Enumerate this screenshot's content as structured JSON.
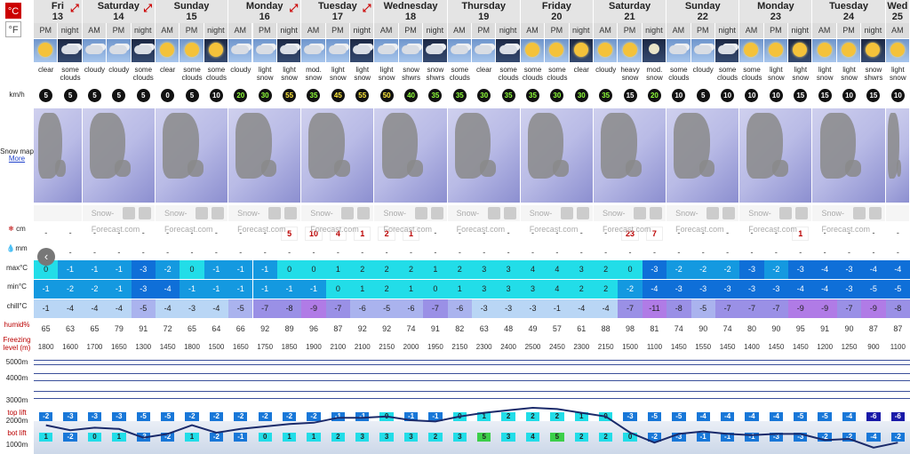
{
  "units": {
    "celsius": "°C",
    "fahrenheit": "°F"
  },
  "labels": {
    "wind": "km/h",
    "snowmap": "Snow map",
    "more": "More",
    "snow_cm": "cm",
    "rain_mm": "mm",
    "max": "max°C",
    "min": "min°C",
    "chill": "chill°C",
    "humid": "humid%",
    "freezing": "Freezing level (m)",
    "m5000": "5000m",
    "m4000": "4000m",
    "m3000": "3000m",
    "m2000": "2000m",
    "m1000": "1000m",
    "top_lift": "top lift",
    "bot_lift": "bot lift",
    "brand": "Snow-Forecast.com"
  },
  "days": [
    {
      "name": "Fri",
      "date": "13",
      "arrow": true,
      "periods": 2
    },
    {
      "name": "Saturday",
      "date": "14",
      "arrow": true,
      "periods": 3
    },
    {
      "name": "Sunday",
      "date": "15",
      "arrow": false,
      "periods": 3
    },
    {
      "name": "Monday",
      "date": "16",
      "arrow": true,
      "periods": 3
    },
    {
      "name": "Tuesday",
      "date": "17",
      "arrow": true,
      "periods": 3
    },
    {
      "name": "Wednesday",
      "date": "18",
      "arrow": false,
      "periods": 3
    },
    {
      "name": "Thursday",
      "date": "19",
      "arrow": false,
      "periods": 3
    },
    {
      "name": "Friday",
      "date": "20",
      "arrow": false,
      "periods": 3
    },
    {
      "name": "Saturday",
      "date": "21",
      "arrow": false,
      "periods": 3
    },
    {
      "name": "Sunday",
      "date": "22",
      "arrow": false,
      "periods": 3
    },
    {
      "name": "Monday",
      "date": "23",
      "arrow": false,
      "periods": 3
    },
    {
      "name": "Tuesday",
      "date": "24",
      "arrow": false,
      "periods": 3
    },
    {
      "name": "Wed",
      "date": "25",
      "arrow": false,
      "periods": 1
    }
  ],
  "periods": [
    "PM",
    "night",
    "AM",
    "PM",
    "night",
    "AM",
    "PM",
    "night",
    "AM",
    "PM",
    "night",
    "AM",
    "PM",
    "night",
    "AM",
    "PM",
    "night",
    "AM",
    "PM",
    "night",
    "AM",
    "PM",
    "night",
    "AM",
    "PM",
    "night",
    "AM",
    "PM",
    "night",
    "AM",
    "PM",
    "night",
    "AM",
    "PM",
    "night",
    "AM"
  ],
  "icons": [
    "sun",
    "cloud-night",
    "cloud",
    "cloud",
    "cloud-night",
    "sun",
    "sun",
    "sun",
    "cloud",
    "cloud",
    "cloud-night",
    "cloud",
    "cloud",
    "cloud",
    "cloud",
    "cloud",
    "cloud",
    "cloud",
    "cloud",
    "cloud",
    "sun",
    "sun",
    "sun",
    "sun",
    "sun",
    "moon",
    "cloud",
    "cloud",
    "cloud-night",
    "sun",
    "sun",
    "sun",
    "sun",
    "sun",
    "sun",
    "sun"
  ],
  "desc": [
    "clear",
    "some clouds",
    "cloudy",
    "cloudy",
    "some clouds",
    "clear",
    "some clouds",
    "some clouds",
    "cloudy",
    "light snow",
    "light snow",
    "mod. snow",
    "light snow",
    "light snow",
    "light snow",
    "snow shwrs",
    "snow shwrs",
    "some clouds",
    "clear",
    "some clouds",
    "some clouds",
    "some clouds",
    "clear",
    "cloudy",
    "heavy snow",
    "mod. snow",
    "some clouds",
    "cloudy",
    "some clouds",
    "some clouds",
    "light snow",
    "light snow",
    "light snow",
    "light snow",
    "snow shwrs",
    "light snow"
  ],
  "wind": [
    "5",
    "5",
    "5",
    "5",
    "5",
    "0",
    "5",
    "10",
    "20",
    "30",
    "55",
    "35",
    "45",
    "55",
    "50",
    "40",
    "35",
    "35",
    "30",
    "35",
    "35",
    "30",
    "30",
    "35",
    "15",
    "20",
    "10",
    "5",
    "10",
    "10",
    "10",
    "15",
    "15",
    "10",
    "15",
    "10"
  ],
  "snow": [
    "-",
    "-",
    "-",
    "-",
    "-",
    "-",
    "-",
    "-",
    "-",
    "-",
    "5",
    "10",
    "4",
    "1",
    "2",
    "1",
    "-",
    "-",
    "-",
    "-",
    "-",
    "-",
    "-",
    "-",
    "23",
    "7",
    "-",
    "-",
    "-",
    "-",
    "-",
    "1",
    "-",
    "-",
    "-",
    "-"
  ],
  "rain": [
    "-",
    "-",
    "-",
    "-",
    "-",
    "-",
    "-",
    "-",
    "-",
    "-",
    "-",
    "-",
    "-",
    "-",
    "-",
    "-",
    "-",
    "-",
    "-",
    "-",
    "-",
    "-",
    "-",
    "-",
    "-",
    "-",
    "-",
    "-",
    "-",
    "-",
    "-",
    "-",
    "-",
    "-",
    "-",
    "-"
  ],
  "max": [
    "0",
    "-1",
    "-1",
    "-1",
    "-3",
    "-2",
    "0",
    "-1",
    "-1",
    "-1",
    "0",
    "0",
    "1",
    "2",
    "2",
    "2",
    "1",
    "2",
    "3",
    "3",
    "4",
    "4",
    "3",
    "2",
    "0",
    "-3",
    "-2",
    "-2",
    "-2",
    "-3",
    "-2",
    "-3",
    "-4",
    "-3",
    "-4",
    "-4"
  ],
  "min": [
    "-1",
    "-2",
    "-2",
    "-1",
    "-3",
    "-4",
    "-1",
    "-1",
    "-1",
    "-1",
    "-1",
    "-1",
    "0",
    "1",
    "2",
    "1",
    "0",
    "1",
    "3",
    "3",
    "3",
    "4",
    "2",
    "2",
    "-2",
    "-4",
    "-3",
    "-3",
    "-3",
    "-3",
    "-3",
    "-4",
    "-4",
    "-3",
    "-5",
    "-5"
  ],
  "chill": [
    "-1",
    "-4",
    "-4",
    "-4",
    "-5",
    "-4",
    "-3",
    "-4",
    "-5",
    "-7",
    "-8",
    "-9",
    "-7",
    "-6",
    "-5",
    "-6",
    "-7",
    "-6",
    "-3",
    "-3",
    "-3",
    "-1",
    "-4",
    "-4",
    "-7",
    "-11",
    "-8",
    "-5",
    "-7",
    "-7",
    "-7",
    "-9",
    "-9",
    "-7",
    "-9",
    "-8"
  ],
  "humid": [
    "65",
    "63",
    "65",
    "79",
    "91",
    "72",
    "65",
    "64",
    "66",
    "92",
    "89",
    "96",
    "87",
    "92",
    "92",
    "74",
    "91",
    "82",
    "63",
    "48",
    "49",
    "57",
    "61",
    "88",
    "98",
    "81",
    "74",
    "90",
    "74",
    "80",
    "90",
    "95",
    "91",
    "90",
    "87",
    "87"
  ],
  "freezing": [
    "1800",
    "1600",
    "1700",
    "1650",
    "1300",
    "1450",
    "1800",
    "1500",
    "1650",
    "1750",
    "1850",
    "1900",
    "2100",
    "2100",
    "2150",
    "2000",
    "1950",
    "2150",
    "2300",
    "2400",
    "2500",
    "2450",
    "2300",
    "2150",
    "1500",
    "1100",
    "1450",
    "1550",
    "1450",
    "1400",
    "1450",
    "1450",
    "1200",
    "1250",
    "900",
    "1100"
  ],
  "top_lift": [
    "-2",
    "-3",
    "-3",
    "-3",
    "-5",
    "-5",
    "-2",
    "-2",
    "-2",
    "-2",
    "-2",
    "-2",
    "-1",
    "-1",
    "0",
    "-1",
    "-1",
    "0",
    "1",
    "2",
    "2",
    "2",
    "1",
    "0",
    "-3",
    "-5",
    "-5",
    "-4",
    "-4",
    "-4",
    "-4",
    "-5",
    "-5",
    "-4",
    "-6",
    "-6"
  ],
  "bot_lift": [
    "1",
    "-2",
    "0",
    "1",
    "-3",
    "-2",
    "1",
    "-2",
    "-1",
    "0",
    "1",
    "1",
    "2",
    "3",
    "3",
    "3",
    "2",
    "3",
    "5",
    "3",
    "4",
    "5",
    "2",
    "2",
    "0",
    "-2",
    "-3",
    "-1",
    "-1",
    "-1",
    "-3",
    "-3",
    "-2",
    "-2",
    "-4",
    "-2"
  ],
  "ui": {
    "prev": "‹"
  }
}
